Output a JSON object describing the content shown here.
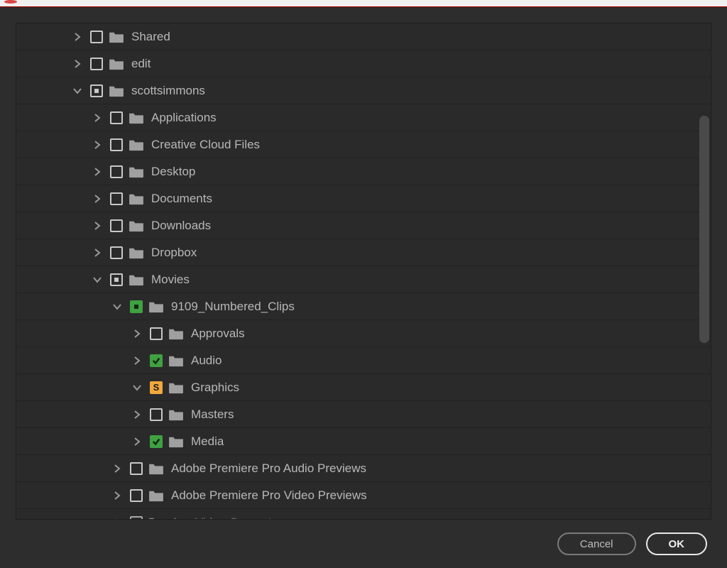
{
  "buttons": {
    "cancel": "Cancel",
    "ok": "OK"
  },
  "tree": [
    {
      "label": "Shared",
      "indent": 1,
      "disclosure": "right",
      "check": "empty"
    },
    {
      "label": "edit",
      "indent": 1,
      "disclosure": "right",
      "check": "empty"
    },
    {
      "label": "scottsimmons",
      "indent": 1,
      "disclosure": "down",
      "check": "partial-gray"
    },
    {
      "label": "Applications",
      "indent": 2,
      "disclosure": "right",
      "check": "empty"
    },
    {
      "label": "Creative Cloud Files",
      "indent": 2,
      "disclosure": "right",
      "check": "empty"
    },
    {
      "label": "Desktop",
      "indent": 2,
      "disclosure": "right",
      "check": "empty"
    },
    {
      "label": "Documents",
      "indent": 2,
      "disclosure": "right",
      "check": "empty"
    },
    {
      "label": "Downloads",
      "indent": 2,
      "disclosure": "right",
      "check": "empty"
    },
    {
      "label": "Dropbox",
      "indent": 2,
      "disclosure": "right",
      "check": "empty"
    },
    {
      "label": "Movies",
      "indent": 2,
      "disclosure": "down",
      "check": "partial-gray"
    },
    {
      "label": "9109_Numbered_Clips",
      "indent": 3,
      "disclosure": "down",
      "check": "partial-green"
    },
    {
      "label": "Approvals",
      "indent": 4,
      "disclosure": "right",
      "check": "empty"
    },
    {
      "label": "Audio",
      "indent": 4,
      "disclosure": "right",
      "check": "checked-green"
    },
    {
      "label": "Graphics",
      "indent": 4,
      "disclosure": "down",
      "check": "s-badge"
    },
    {
      "label": "Masters",
      "indent": 4,
      "disclosure": "right",
      "check": "empty"
    },
    {
      "label": "Media",
      "indent": 4,
      "disclosure": "right",
      "check": "checked-green"
    },
    {
      "label": "Adobe Premiere Pro Audio Previews",
      "indent": 3,
      "disclosure": "right",
      "check": "empty"
    },
    {
      "label": "Adobe Premiere Pro Video Previews",
      "indent": 3,
      "disclosure": "right",
      "check": "empty"
    },
    {
      "label": "Any Video Converter",
      "indent": 3,
      "disclosure": "right",
      "check": "empty",
      "cut": true
    }
  ]
}
